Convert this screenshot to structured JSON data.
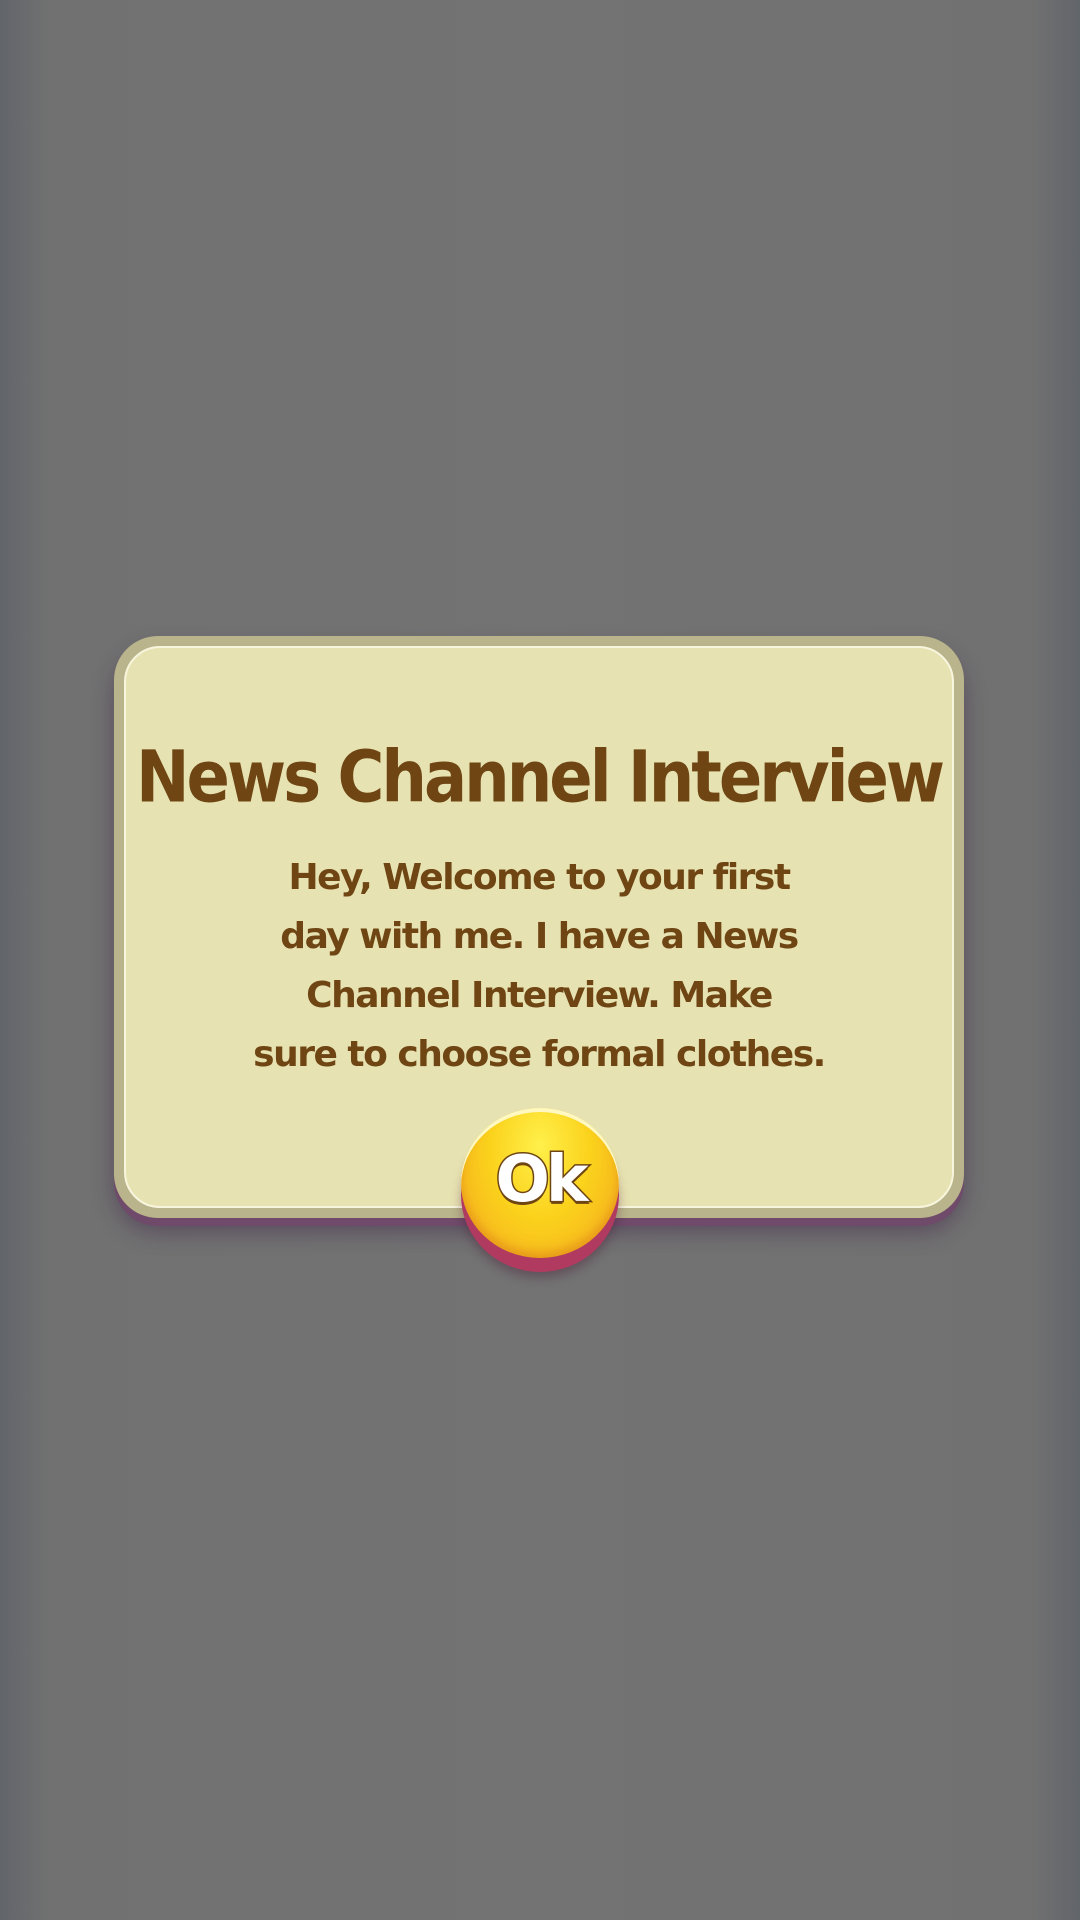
{
  "dialog": {
    "title": "News Channel Interview",
    "message_lines": [
      "Hey, Welcome to your first",
      "day with me. I have a News",
      "Channel Interview. Make",
      "sure to choose formal clothes."
    ],
    "ok_label": "Ok"
  },
  "colors": {
    "backdrop": "#737373",
    "panel_frame": "#b9b48b",
    "panel_fill": "#e7e2b2",
    "text_brown": "#6e4513",
    "button_yellow": "#fbd21c",
    "button_base": "#b13a60"
  }
}
